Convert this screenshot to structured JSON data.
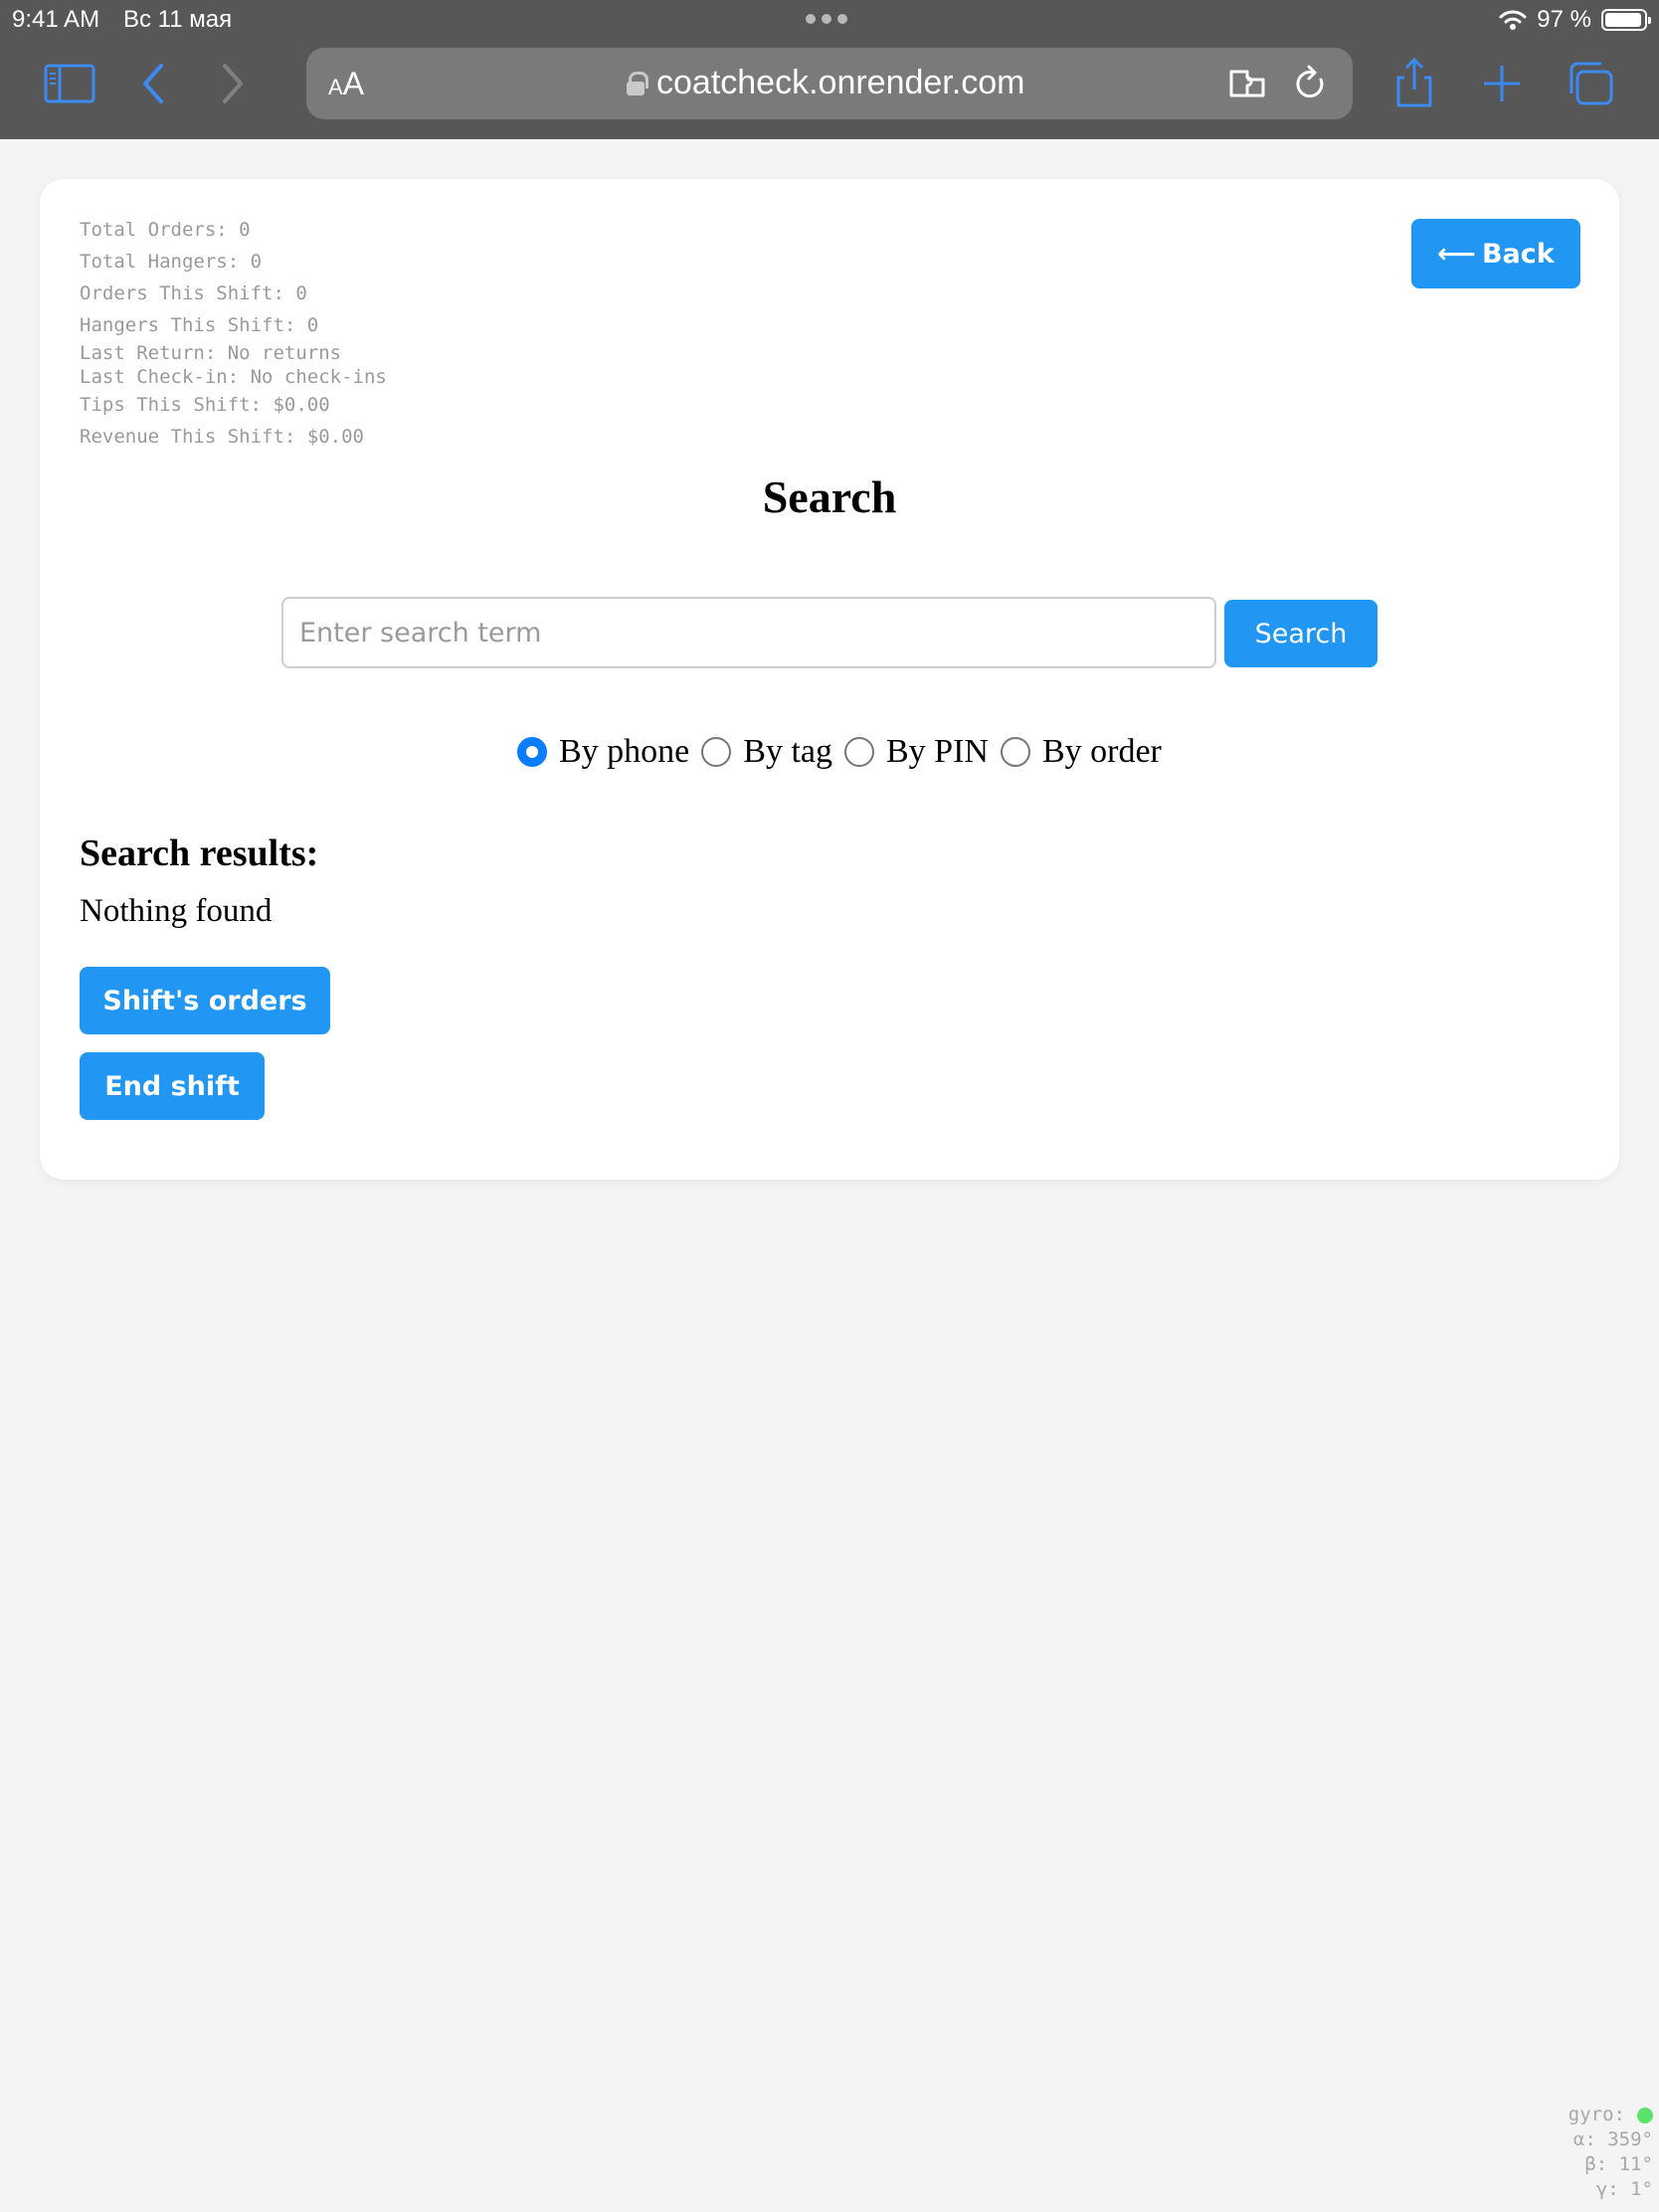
{
  "status_bar": {
    "time": "9:41 AM",
    "date": "Вс 11 мая",
    "battery": "97 %"
  },
  "browser": {
    "text_size_label_small": "A",
    "text_size_label_large": "A",
    "url": "coatcheck.onrender.com"
  },
  "stats": {
    "total_orders": "Total Orders: 0",
    "total_hangers": "Total Hangers: 0",
    "orders_shift": "Orders This Shift: 0",
    "hangers_shift": "Hangers This Shift: 0",
    "last_return": "Last Return: No returns",
    "last_checkin": "Last Check-in: No check-ins",
    "tips_shift": "Tips This Shift: $0.00",
    "revenue_shift": "Revenue This Shift: $0.00"
  },
  "back_button": {
    "arrow": "⟵",
    "label": "Back"
  },
  "search": {
    "title": "Search",
    "placeholder": "Enter search term",
    "value": "",
    "button_label": "Search",
    "options": [
      {
        "label": "By phone",
        "checked": true
      },
      {
        "label": "By tag",
        "checked": false
      },
      {
        "label": "By PIN",
        "checked": false
      },
      {
        "label": "By order",
        "checked": false
      }
    ]
  },
  "results": {
    "heading": "Search results:",
    "empty_message": "Nothing found"
  },
  "actions": {
    "shift_orders_label": "Shift's orders",
    "end_shift_label": "End shift"
  },
  "gyro": {
    "label": "gyro:",
    "alpha": "α: 359°",
    "beta": "β: 11°",
    "gamma": "γ: 1°"
  },
  "colors": {
    "accent": "#2196f3",
    "radio_checked": "#0a7cff",
    "page_bg": "#f4f4f4",
    "chrome_bg": "#575757",
    "gyro_indicator": "#5be36b"
  }
}
